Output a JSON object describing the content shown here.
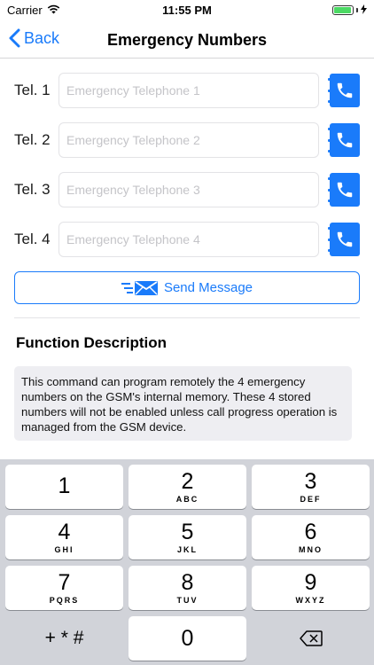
{
  "status_bar": {
    "carrier": "Carrier",
    "time": "11:55 PM",
    "battery_level": 0.95,
    "battery_color": "#4cd964",
    "icons": [
      "wifi-icon",
      "battery-icon",
      "charging-icon"
    ]
  },
  "nav": {
    "back_label": "Back",
    "title": "Emergency Numbers"
  },
  "tel_rows": [
    {
      "label": "Tel. 1",
      "placeholder": "Emergency Telephone 1"
    },
    {
      "label": "Tel. 2",
      "placeholder": "Emergency Telephone 2"
    },
    {
      "label": "Tel. 3",
      "placeholder": "Emergency Telephone 3"
    },
    {
      "label": "Tel. 4",
      "placeholder": "Emergency Telephone 4"
    }
  ],
  "send_button": {
    "label": "Send Message",
    "icon": "fast-mail-icon"
  },
  "function": {
    "title": "Function Description",
    "description": "This command can program remotely the 4 emergency numbers on the GSM's internal memory. These 4 stored numbers will not be enabled unless call progress operation is managed from the GSM device."
  },
  "keypad": {
    "keys": [
      {
        "num": "1",
        "letters": ""
      },
      {
        "num": "2",
        "letters": "ABC"
      },
      {
        "num": "3",
        "letters": "DEF"
      },
      {
        "num": "4",
        "letters": "GHI"
      },
      {
        "num": "5",
        "letters": "JKL"
      },
      {
        "num": "6",
        "letters": "MNO"
      },
      {
        "num": "7",
        "letters": "PQRS"
      },
      {
        "num": "8",
        "letters": "TUV"
      },
      {
        "num": "9",
        "letters": "WXYZ"
      }
    ],
    "symbols_label": "+ * #",
    "zero": "0",
    "delete_icon": "backspace-icon"
  },
  "colors": {
    "accent": "#1a7bfa",
    "keyboard_bg": "#d1d3d9"
  }
}
